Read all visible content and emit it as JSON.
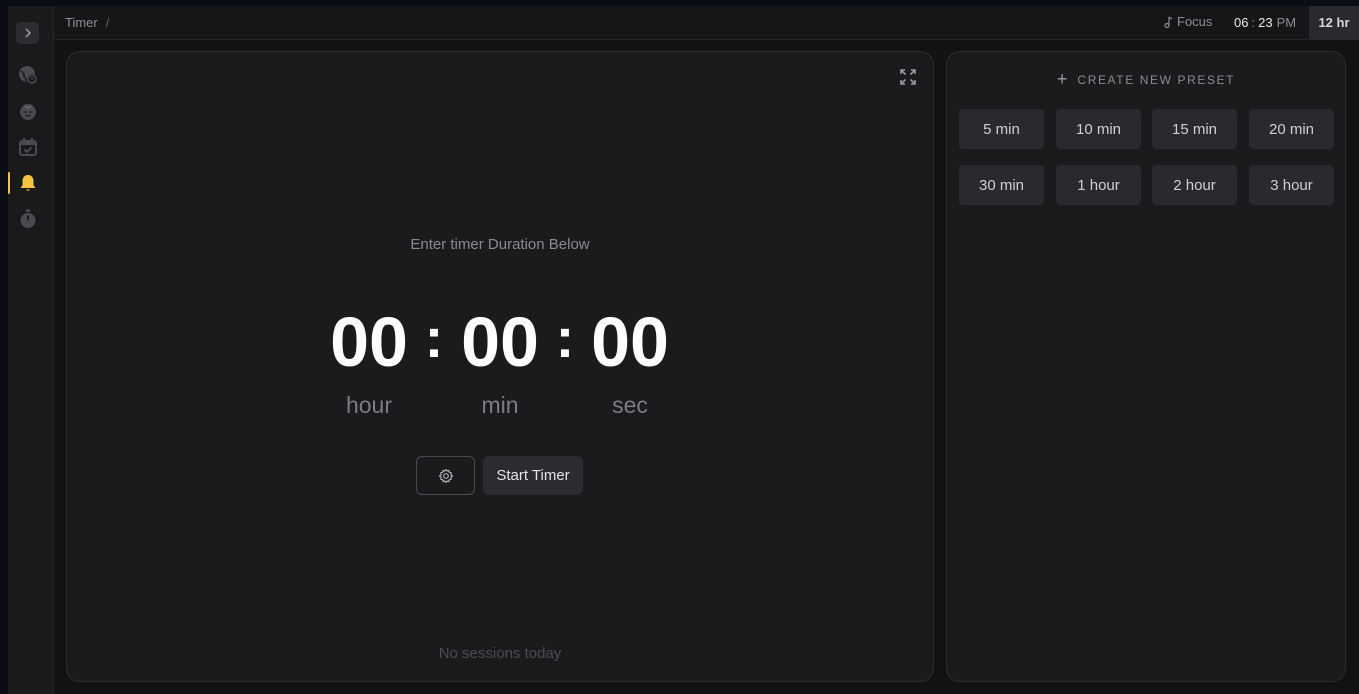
{
  "breadcrumb": {
    "title": "Timer",
    "separator": "/"
  },
  "topbar": {
    "focus_label": "Focus",
    "clock": {
      "hours": "06",
      "minutes": "23",
      "ampm": "PM"
    },
    "format_toggle": "12 hr"
  },
  "sidebar": {
    "items": [
      {
        "icon": "world-clock-icon"
      },
      {
        "icon": "tomato-icon"
      },
      {
        "icon": "calendar-icon"
      },
      {
        "icon": "bell-icon",
        "active": true
      },
      {
        "icon": "stopwatch-icon"
      }
    ]
  },
  "timer": {
    "hint": "Enter timer Duration Below",
    "hours": "00",
    "minutes": "00",
    "seconds": "00",
    "colon": ":",
    "units": {
      "hour": "hour",
      "min": "min",
      "sec": "sec"
    },
    "start_label": "Start Timer",
    "sessions_text": "No sessions today"
  },
  "presets": {
    "create_label": "CREATE NEW PRESET",
    "plus": "+",
    "items": [
      "5 min",
      "10 min",
      "15 min",
      "20 min",
      "30 min",
      "1 hour",
      "2 hour",
      "3 hour"
    ]
  },
  "colors": {
    "accent": "#f5c542",
    "background": "#121215",
    "panel": "#1b1b1e"
  }
}
